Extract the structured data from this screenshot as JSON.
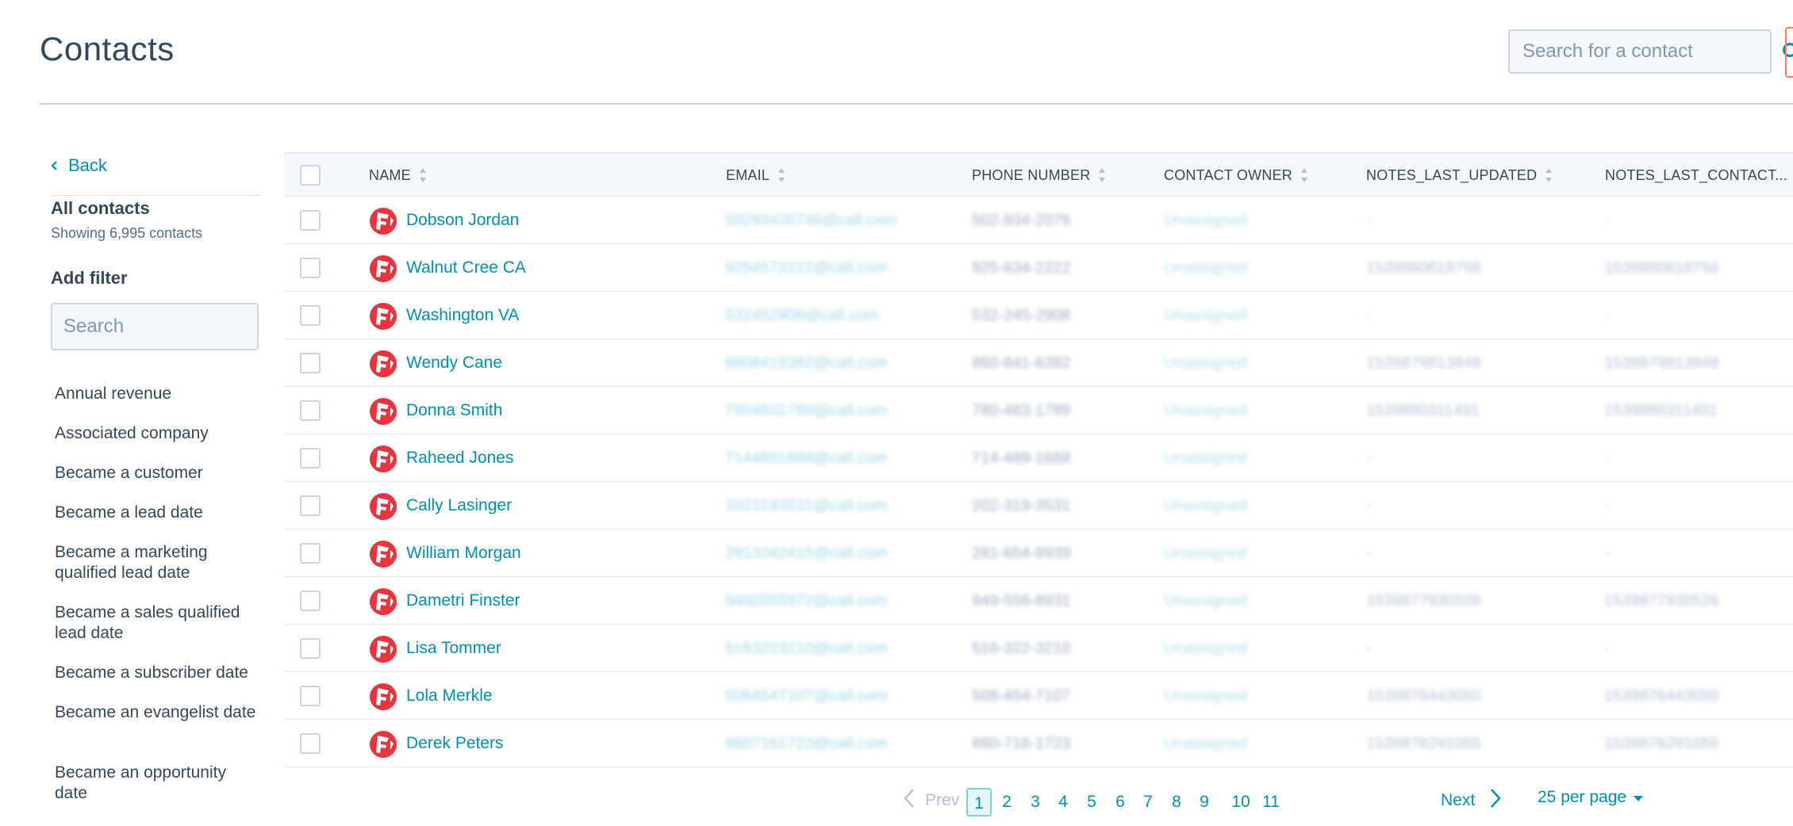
{
  "header": {
    "title": "Contacts",
    "search_placeholder": "Search for a contact"
  },
  "sidebar": {
    "back_label": "Back",
    "list_title": "All contacts",
    "showing": "Showing 6,995 contacts",
    "add_filter": "Add filter",
    "filter_search_placeholder": "Search",
    "filters": [
      "Annual revenue",
      "Associated company",
      "Became a customer",
      "Became a lead date",
      "Became a marketing qualified lead date",
      "Became a sales qualified lead date",
      "Became a subscriber date",
      "Became an evangelist date",
      "Became an opportunity date"
    ]
  },
  "table": {
    "columns": {
      "name": "NAME",
      "email": "EMAIL",
      "phone": "PHONE NUMBER",
      "owner": "CONTACT OWNER",
      "notes_last_updated": "NOTES_LAST_UPDATED",
      "notes_last_contacted": "NOTES_LAST_CONTACT..."
    },
    "rows": [
      {
        "name": "Dobson Jordan",
        "email": "50293420746@call.com",
        "phone": "502-934-2076",
        "owner": "Unassigned",
        "notes_last_updated": "-",
        "notes_last_contacted": "-"
      },
      {
        "name": "Walnut Cree CA",
        "email": "9254572222@call.com",
        "phone": "925-634-2222",
        "owner": "Unassigned",
        "notes_last_updated": "1539880618756",
        "notes_last_contacted": "1539880618756"
      },
      {
        "name": "Washington VA",
        "email": "532452908@call.com",
        "phone": "532-245-2908",
        "owner": "Unassigned",
        "notes_last_updated": "-",
        "notes_last_contacted": "-"
      },
      {
        "name": "Wendy Cane",
        "email": "8608416382@call.com",
        "phone": "860-841-6382",
        "owner": "Unassigned",
        "notes_last_updated": "1539879813848",
        "notes_last_contacted": "1539879813848"
      },
      {
        "name": "Donna Smith",
        "email": "7804831789@call.com",
        "phone": "780-483-1789",
        "owner": "Unassigned",
        "notes_last_updated": "1539880311491",
        "notes_last_contacted": "1539880311491"
      },
      {
        "name": "Raheed Jones",
        "email": "7144891668@call.com",
        "phone": "714-489-1668",
        "owner": "Unassigned",
        "notes_last_updated": "-",
        "notes_last_contacted": "-"
      },
      {
        "name": "Cally Lasinger",
        "email": "2023193531@call.com",
        "phone": "202-319-3531",
        "owner": "Unassigned",
        "notes_last_updated": "-",
        "notes_last_contacted": "-"
      },
      {
        "name": "William Morgan",
        "email": "2813342415@call.com",
        "phone": "281-654-9939",
        "owner": "Unassigned",
        "notes_last_updated": "-",
        "notes_last_contacted": "-"
      },
      {
        "name": "Dametri Finster",
        "email": "9492055972@call.com",
        "phone": "949-556-8931",
        "owner": "Unassigned",
        "notes_last_updated": "1539877930526",
        "notes_last_contacted": "1539877930526"
      },
      {
        "name": "Lisa Tommer",
        "email": "5163223210@call.com",
        "phone": "516-322-3210",
        "owner": "Unassigned",
        "notes_last_updated": "-",
        "notes_last_contacted": "-"
      },
      {
        "name": "Lola Merkle",
        "email": "5084547107@call.com",
        "phone": "508-454-7107",
        "owner": "Unassigned",
        "notes_last_updated": "1539876443050",
        "notes_last_contacted": "1539876443050"
      },
      {
        "name": "Derek Peters",
        "email": "8607161723@call.com",
        "phone": "860-716-1723",
        "owner": "Unassigned",
        "notes_last_updated": "1539876291055",
        "notes_last_contacted": "1539876291055"
      }
    ]
  },
  "pagination": {
    "prev": "Prev",
    "next": "Next",
    "pages": [
      "1",
      "2",
      "3",
      "4",
      "5",
      "6",
      "7",
      "8",
      "9",
      "10",
      "11"
    ],
    "current": "1",
    "per_page": "25 per page"
  },
  "colors": {
    "link": "#0091ae",
    "text": "#33475b",
    "avatar": "#e8343c",
    "accent_orange": "#ff7a59"
  },
  "icons": {
    "search": "search-icon",
    "back": "chevron-left-icon",
    "sort": "sort-icon",
    "next": "chevron-right-icon",
    "prev": "chevron-left-icon",
    "per_page": "caret-down-icon"
  }
}
